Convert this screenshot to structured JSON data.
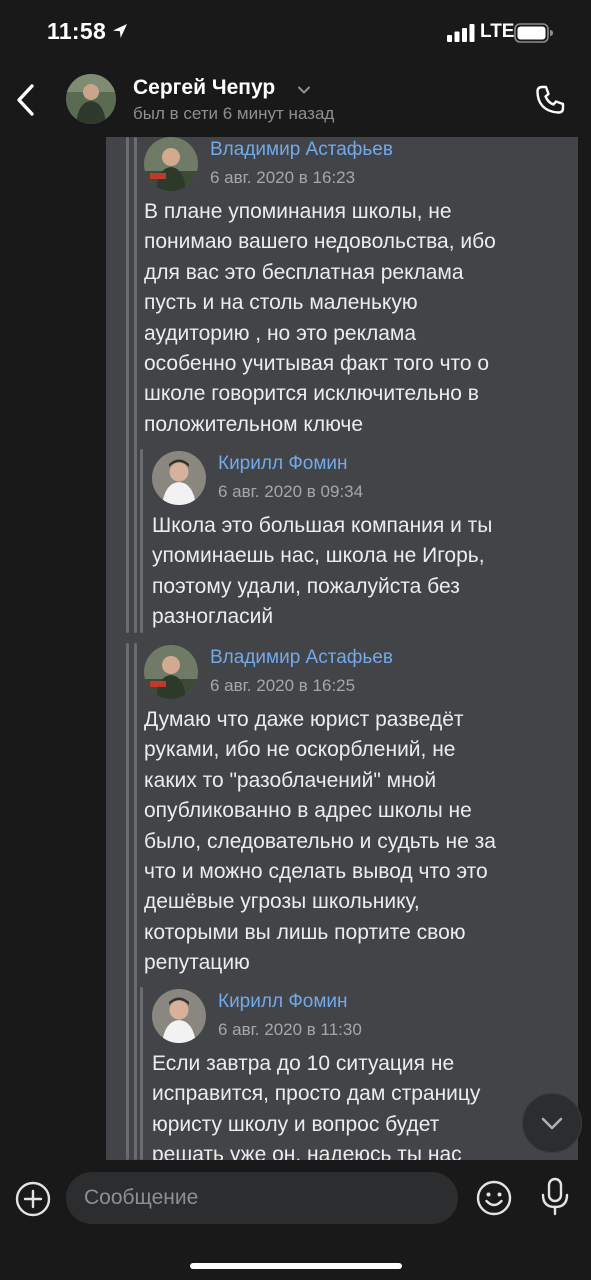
{
  "status_bar": {
    "time": "11:58",
    "network": "LTE",
    "location_icon": "location-arrow-icon",
    "signal_icon": "cellular-signal-icon",
    "battery_icon": "battery-icon"
  },
  "header": {
    "back_icon": "chevron-left-icon",
    "name": "Сергей Чепур",
    "name_icon": "chevron-down-icon",
    "status": "был в сети 6 минут назад",
    "call_icon": "phone-icon"
  },
  "forwards": [
    {
      "author": "Владимир Астафьев",
      "date": "6 авг. 2020 в 16:23",
      "text": "В плане упоминания школы, не\nпонимаю вашего недовольства, ибо\nдля вас это бесплатная реклама\nпусть и на столь маленькую\nаудиторию , но это реклама\nособенно учитывая факт того что о\nшколе говорится исключительно в\nположительном ключе"
    },
    {
      "author": "Кирилл Фомин",
      "date": "6 авг. 2020 в 09:34",
      "text": "Школа это большая компания и ты\nупоминаешь нас, школа не Игорь,\nпоэтому удали, пожалуйста без\nразногласий"
    },
    {
      "author": "Владимир Астафьев",
      "date": "6 авг. 2020 в 16:25",
      "text": "Думаю что даже юрист разведёт\nруками, ибо не оскорблений, не\nкаких то \"разоблачений\" мной\nопубликованно в адрес школы не\nбыло, следовательно и судьть не за\nчто и можно сделать вывод что это\nдешёвые угрозы школьнику,\nкоторыми вы лишь портите свою\nрепутацию"
    },
    {
      "author": "Кирилл Фомин",
      "date": "6 авг. 2020 в 11:30",
      "text": "Если завтра до 10 ситуация не\nисправится, просто дам страницу\nюристу школу и вопрос будет\nрешать уже он, надеюсь ты нас"
    }
  ],
  "scroll_down_icon": "chevron-down-icon",
  "composer": {
    "attach_icon": "plus-circle-icon",
    "placeholder": "Сообщение",
    "emoji_icon": "smile-icon",
    "mic_icon": "microphone-icon"
  },
  "colors": {
    "background": "#19191a",
    "bubble": "#434447",
    "author_link": "#71aaeb",
    "text": "#ebecee",
    "muted": "#8d8f93"
  }
}
